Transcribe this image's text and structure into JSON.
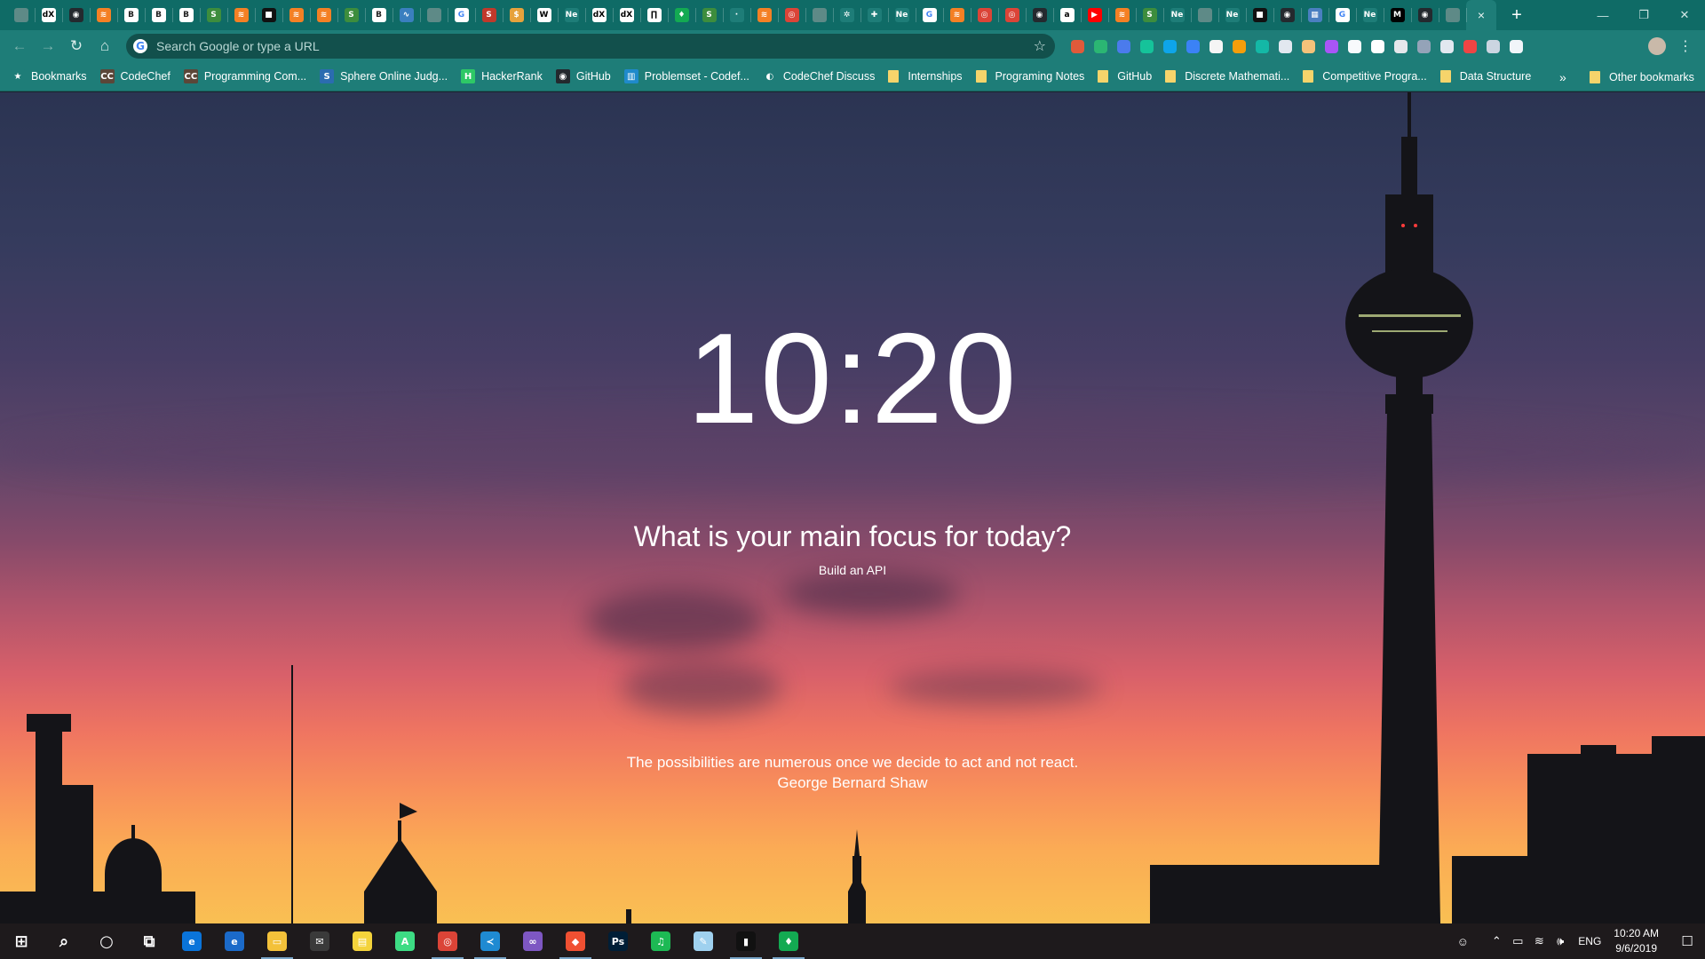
{
  "browser": {
    "tabs": [
      {
        "icon": "blank-icon",
        "color": "#5e8a87",
        "text": ""
      },
      {
        "icon": "edx-icon",
        "color": "#ffffff",
        "text": "dX",
        "fg": "#000000"
      },
      {
        "icon": "github-icon",
        "color": "#24292e",
        "text": "◉"
      },
      {
        "icon": "stackoverflow-icon",
        "color": "#f48024",
        "text": "≋"
      },
      {
        "icon": "bootstrap-icon",
        "color": "#ffffff",
        "text": "B",
        "fg": "#222222"
      },
      {
        "icon": "bootstrap-icon",
        "color": "#ffffff",
        "text": "B",
        "fg": "#222222"
      },
      {
        "icon": "bootstrap-icon",
        "color": "#ffffff",
        "text": "B",
        "fg": "#222222"
      },
      {
        "icon": "page-icon",
        "color": "#3d8d3d",
        "text": "S"
      },
      {
        "icon": "stackoverflow-icon",
        "color": "#f48024",
        "text": "≋"
      },
      {
        "icon": "briefcase-icon",
        "color": "#111111",
        "text": "■"
      },
      {
        "icon": "stackoverflow-icon",
        "color": "#f48024",
        "text": "≋"
      },
      {
        "icon": "stackoverflow-icon",
        "color": "#f48024",
        "text": "≋"
      },
      {
        "icon": "page-icon",
        "color": "#3d8d3d",
        "text": "S"
      },
      {
        "icon": "bootstrap-icon",
        "color": "#ffffff",
        "text": "B",
        "fg": "#222222"
      },
      {
        "icon": "chart-icon",
        "color": "#3a7fbf",
        "text": "∿"
      },
      {
        "icon": "blank-icon",
        "color": "#5e8a87",
        "text": ""
      },
      {
        "icon": "google-icon",
        "color": "#ffffff",
        "text": "G",
        "fg": "#4285f4"
      },
      {
        "icon": "s-icon",
        "color": "#c0392b",
        "text": "S"
      },
      {
        "icon": "s-icon",
        "color": "#e6a23c",
        "text": "$"
      },
      {
        "icon": "wikipedia-icon",
        "color": "#ffffff",
        "text": "W",
        "fg": "#000000"
      },
      {
        "icon": "ne-icon",
        "color": "#1e7d78",
        "text": "Ne"
      },
      {
        "icon": "edx-icon",
        "color": "#ffffff",
        "text": "dX",
        "fg": "#000000"
      },
      {
        "icon": "edx-icon",
        "color": "#ffffff",
        "text": "dX",
        "fg": "#000000"
      },
      {
        "icon": "book-icon",
        "color": "#ffffff",
        "text": "∏",
        "fg": "#000000"
      },
      {
        "icon": "mongodb-icon",
        "color": "#13aa52",
        "text": "♦"
      },
      {
        "icon": "page-icon",
        "color": "#3d8d3d",
        "text": "S"
      },
      {
        "icon": "blank-icon",
        "color": "#1e7d78",
        "text": "·"
      },
      {
        "icon": "stackoverflow-icon",
        "color": "#f48024",
        "text": "≋"
      },
      {
        "icon": "chrome-icon",
        "color": "#db4437",
        "text": "◎"
      },
      {
        "icon": "blank-icon",
        "color": "#5e8a87",
        "text": ""
      },
      {
        "icon": "settings-icon",
        "color": "#1e7d78",
        "text": "✲"
      },
      {
        "icon": "extensions-icon",
        "color": "#1e7d78",
        "text": "✚"
      },
      {
        "icon": "ne-icon",
        "color": "#1e7d78",
        "text": "Ne"
      },
      {
        "icon": "google-icon",
        "color": "#ffffff",
        "text": "G",
        "fg": "#4285f4"
      },
      {
        "icon": "stackoverflow-icon",
        "color": "#f48024",
        "text": "≋"
      },
      {
        "icon": "chrome-icon",
        "color": "#db4437",
        "text": "◎"
      },
      {
        "icon": "chrome-icon",
        "color": "#db4437",
        "text": "◎"
      },
      {
        "icon": "github-icon",
        "color": "#24292e",
        "text": "◉"
      },
      {
        "icon": "notion-icon",
        "color": "#ffffff",
        "text": "a",
        "fg": "#000000"
      },
      {
        "icon": "youtube-icon",
        "color": "#ff0000",
        "text": "▶"
      },
      {
        "icon": "stackoverflow-icon",
        "color": "#f48024",
        "text": "≋"
      },
      {
        "icon": "page-icon",
        "color": "#3d8d3d",
        "text": "S"
      },
      {
        "icon": "ne-icon",
        "color": "#1e7d78",
        "text": "Ne"
      },
      {
        "icon": "blank-icon",
        "color": "#5e8a87",
        "text": ""
      },
      {
        "icon": "ne-icon",
        "color": "#1e7d78",
        "text": "Ne"
      },
      {
        "icon": "briefcase-icon",
        "color": "#111111",
        "text": "■"
      },
      {
        "icon": "github-icon",
        "color": "#24292e",
        "text": "◉"
      },
      {
        "icon": "photo-icon",
        "color": "#4a7fc1",
        "text": "▦"
      },
      {
        "icon": "google-icon",
        "color": "#ffffff",
        "text": "G",
        "fg": "#4285f4"
      },
      {
        "icon": "ne-icon",
        "color": "#1e7d78",
        "text": "Ne"
      },
      {
        "icon": "medium-icon",
        "color": "#000000",
        "text": "M"
      },
      {
        "icon": "github-icon",
        "color": "#24292e",
        "text": "◉"
      },
      {
        "icon": "blank-icon",
        "color": "#5e8a87",
        "text": ""
      }
    ],
    "active_tab_close": "×",
    "new_tab": "+",
    "window": {
      "minimize": "—",
      "restore": "❐",
      "close": "✕"
    },
    "omnibox_placeholder": "Search Google or type a URL",
    "extensions": [
      "#e05a3a",
      "#2bb673",
      "#4b7bec",
      "#15c39a",
      "#0ea5e9",
      "#3b82f6",
      "#f5f5f5",
      "#f59e0b",
      "#14b8a6",
      "#e2e8f0",
      "#f4c27a",
      "#a855f7",
      "#f8fafc",
      "#ffffff",
      "#e5e7eb",
      "#94a3b8",
      "#e2e8f0",
      "#ef4444",
      "#cbd5e1",
      "#f1f5f9"
    ]
  },
  "bookmarks": {
    "items": [
      {
        "label": "Bookmarks",
        "icon": "star-icon",
        "glyph": "★",
        "color": "#1e7d78"
      },
      {
        "label": "CodeChef",
        "icon": "codechef-icon",
        "glyph": "CC",
        "color": "#5b4638"
      },
      {
        "label": "Programming Com...",
        "icon": "codechef-icon",
        "glyph": "CC",
        "color": "#5b4638"
      },
      {
        "label": "Sphere Online Judg...",
        "icon": "spoj-icon",
        "glyph": "S",
        "color": "#2b6cb0"
      },
      {
        "label": "HackerRank",
        "icon": "hackerrank-icon",
        "glyph": "H",
        "color": "#2ec866"
      },
      {
        "label": "GitHub",
        "icon": "github-icon",
        "glyph": "◉",
        "color": "#24292e"
      },
      {
        "label": "Problemset - Codef...",
        "icon": "codeforces-icon",
        "glyph": "▥",
        "color": "#1f8acb"
      },
      {
        "label": "CodeChef Discuss",
        "icon": "discuss-icon",
        "glyph": "◐",
        "color": "#1e7d78"
      }
    ],
    "folders": [
      "Internships",
      "Programing Notes",
      "GitHub",
      "Discrete Mathemati...",
      "Competitive Progra...",
      "Data Structure"
    ],
    "overflow": "»",
    "other": "Other bookmarks"
  },
  "momentum": {
    "time": "10:20",
    "focus_question": "What is your main focus for today?",
    "focus_answer": "Build an API",
    "quote": "The possibilities are numerous once we decide to act and not react.",
    "quote_author": "George Bernard Shaw"
  },
  "taskbar": {
    "apps": [
      {
        "name": "start-icon",
        "glyph": "⊞",
        "color": "transparent",
        "running": false
      },
      {
        "name": "search-icon",
        "glyph": "⌕",
        "color": "transparent",
        "running": false
      },
      {
        "name": "cortana-icon",
        "glyph": "○",
        "color": "transparent",
        "running": false
      },
      {
        "name": "task-view-icon",
        "glyph": "⧉",
        "color": "transparent",
        "running": false
      },
      {
        "name": "edge-icon",
        "glyph": "e",
        "color": "#0a74da",
        "running": false
      },
      {
        "name": "browser-icon",
        "glyph": "e",
        "color": "#1b6ac9",
        "running": false
      },
      {
        "name": "file-explorer-icon",
        "glyph": "▭",
        "color": "#f3c13a",
        "running": true
      },
      {
        "name": "mail-icon",
        "glyph": "✉",
        "color": "#3a3a3a",
        "running": false
      },
      {
        "name": "sticky-notes-icon",
        "glyph": "▤",
        "color": "#f4d33b",
        "running": false
      },
      {
        "name": "android-studio-icon",
        "glyph": "A",
        "color": "#3ddc84",
        "running": false
      },
      {
        "name": "chrome-icon",
        "glyph": "◎",
        "color": "#db4437",
        "running": true
      },
      {
        "name": "vscode-icon",
        "glyph": "≺",
        "color": "#1f8ad2",
        "running": true
      },
      {
        "name": "visual-studio-icon",
        "glyph": "∞",
        "color": "#7e57c2",
        "running": false
      },
      {
        "name": "git-icon",
        "glyph": "◆",
        "color": "#f05032",
        "running": true
      },
      {
        "name": "photoshop-icon",
        "glyph": "Ps",
        "color": "#001e36",
        "running": false
      },
      {
        "name": "spotify-icon",
        "glyph": "♫",
        "color": "#1db954",
        "running": false
      },
      {
        "name": "notepad-icon",
        "glyph": "✎",
        "color": "#9fd1ef",
        "running": false
      },
      {
        "name": "terminal-icon",
        "glyph": "▮",
        "color": "#111111",
        "running": true
      },
      {
        "name": "mongodb-icon",
        "glyph": "♦",
        "color": "#13aa52",
        "running": true
      }
    ],
    "tray": {
      "people": "☺",
      "chevron": "⌃",
      "battery": "▭",
      "wifi": "≋",
      "volume": "🕪",
      "language": "ENG",
      "time": "10:20 AM",
      "date": "9/6/2019",
      "notifications": "☐"
    }
  }
}
